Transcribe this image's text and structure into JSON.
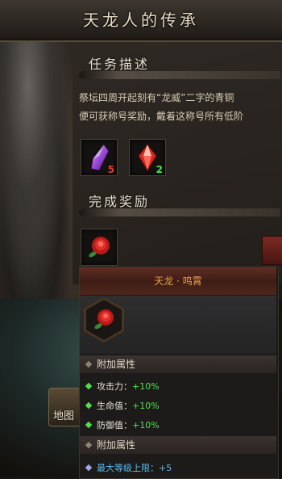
{
  "window": {
    "title": "天龙人的传承"
  },
  "sections": {
    "task_title": "任务描述",
    "task_desc_line1": "祭坛四周开起刻有“龙威”二字的青铜",
    "task_desc_line2": "便可获称号奖励，戴着这称号所有低阶",
    "reward_title": "完成奖励"
  },
  "task_items": [
    {
      "name": "purple-crystal",
      "count": "5",
      "count_color": "#e83a2e"
    },
    {
      "name": "red-crystal",
      "count": "2",
      "count_color": "#3ee84a"
    }
  ],
  "reward_item": {
    "name": "rose"
  },
  "map": {
    "label": "地图"
  },
  "tooltip": {
    "title": "天龙 · 鸣霄",
    "title_color": "#e8a24a",
    "attr_header_1": "附加属性",
    "stats": [
      {
        "label": "攻击力：",
        "value": "+10%"
      },
      {
        "label": "生命值：",
        "value": "+10%"
      },
      {
        "label": "防御值：",
        "value": "+10%"
      }
    ],
    "attr_header_2": "附加属性",
    "extra_stat": {
      "label": "最大等级上限：",
      "value": "+5"
    }
  },
  "colors": {
    "positive": "#52e04a",
    "special": "#5ab7e8"
  }
}
